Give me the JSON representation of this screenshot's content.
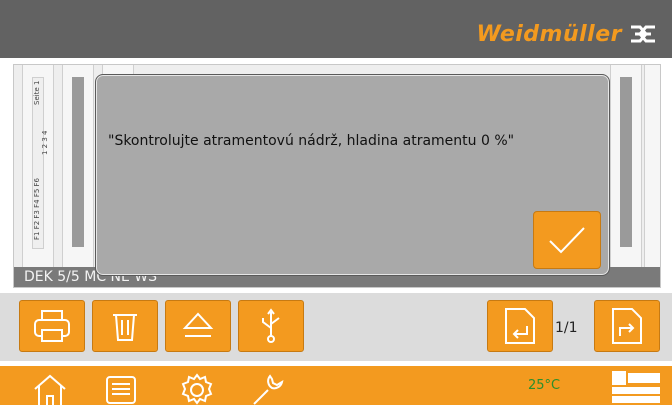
{
  "header": {
    "brand": "Weidmüller",
    "logo_icon": "weidmuller-logo-icon"
  },
  "preview": {
    "strip_labels": [
      "Seite 1",
      "1  2  3  4",
      "F1  F2  F3  F4  F5  F6"
    ],
    "label_name": "DEK 5/5 MC NE WS"
  },
  "dialog": {
    "message": "\"Skontrolujte atramentovú nádrž, hladina atramentu 0 %\"",
    "confirm_icon": "checkmark-icon"
  },
  "toolbar": {
    "buttons": [
      "print-icon",
      "trash-icon",
      "eject-icon",
      "usb-icon"
    ],
    "page_indicator": "1/1",
    "prev_icon": "page-back-icon",
    "next_icon": "page-forward-icon"
  },
  "statusbar": {
    "icons": [
      "home-icon",
      "keyboard-icon",
      "gear-icon",
      "wrench-icon",
      "table-icon"
    ],
    "temperature": "25°C"
  },
  "colors": {
    "accent": "#f39a1f",
    "header": "#626262",
    "dialog": "#a9a9a9",
    "temp_text": "#2c8f2c"
  }
}
